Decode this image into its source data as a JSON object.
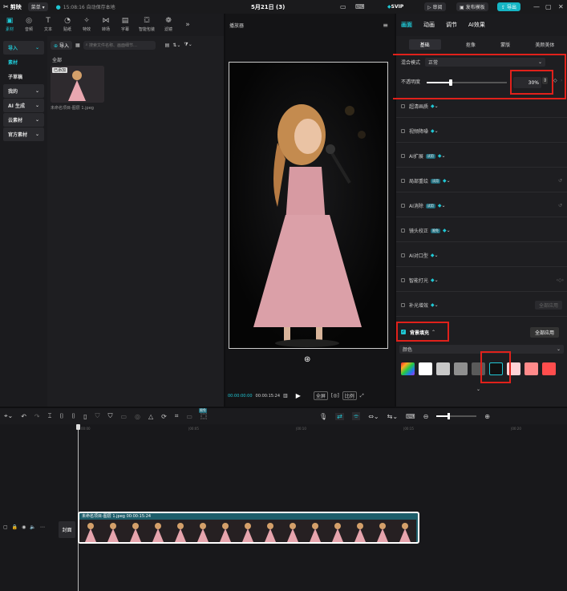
{
  "titlebar": {
    "app_name": "剪映",
    "menu": "菜单",
    "autosave": "15:08:16 自动保存本地",
    "project": "5月21日 (3)",
    "svip": "SVIP",
    "review": "审阅",
    "publish": "发布模板",
    "export": "导出"
  },
  "iconbar": {
    "items": [
      {
        "label": "素材",
        "icon": "media-icon"
      },
      {
        "label": "音频",
        "icon": "audio-icon"
      },
      {
        "label": "文本",
        "icon": "text-icon"
      },
      {
        "label": "贴纸",
        "icon": "sticker-icon"
      },
      {
        "label": "特效",
        "icon": "effects-icon"
      },
      {
        "label": "转场",
        "icon": "transition-icon"
      },
      {
        "label": "字幕",
        "icon": "caption-icon"
      },
      {
        "label": "智能包装",
        "icon": "smart-pack-icon"
      },
      {
        "label": "滤镜",
        "icon": "filter-icon"
      }
    ],
    "more": "»"
  },
  "sidebar": {
    "items": [
      {
        "label": "导入"
      },
      {
        "label": "素材"
      },
      {
        "label": "子草稿"
      },
      {
        "label": "我的"
      },
      {
        "label": "AI 生成"
      },
      {
        "label": "云素材"
      },
      {
        "label": "官方素材"
      }
    ]
  },
  "media": {
    "import_label": "导入",
    "search_placeholder": "搜索文件名称、画面细节…",
    "filter_all": "全部",
    "thumb_badge": "已添加",
    "file_name": "未命名项目-图层 1.jpeg"
  },
  "player": {
    "title": "播放器",
    "time_current": "00:00:00:00",
    "time_total": "00:00:15:24",
    "btn_full": "全屏",
    "btn_ratio": "比例"
  },
  "right": {
    "tabs": [
      "画面",
      "动画",
      "调节",
      "AI效果"
    ],
    "subtabs": [
      "基础",
      "抠像",
      "蒙版",
      "美颜美体"
    ],
    "blend_label": "混合模式",
    "blend_value": "正常",
    "opacity_label": "不透明度",
    "opacity_value": "30%",
    "opacity_fraction": 0.3,
    "rows": [
      "超清画质",
      "视频降噪",
      "AI扩展",
      "局部重绘",
      "AI消除",
      "镜头校正",
      "AI对口型",
      "智能打光",
      "补光增效"
    ],
    "row_pills": [
      "",
      "",
      "试用",
      "试用",
      "试用",
      "限免",
      "",
      "",
      ""
    ],
    "apply_all": "全部应用",
    "bg_fill": "背景填充",
    "bg_apply_all": "全部应用",
    "fill_type": "颜色",
    "swatches": [
      "#ffffff",
      "#c8c8c8",
      "#8f8f8f",
      "#5a5a5a",
      "#111111",
      "#ffd3d6",
      "#ff8a8a",
      "#ff4d4d"
    ]
  },
  "timeline": {
    "ticks": [
      "00:00",
      "|00:05",
      "|00:10",
      "|00:15",
      "|00:20"
    ],
    "clip_label": "未命名项目-图层 1.jpeg  00:00:15:24",
    "cover_label": "封面",
    "badge": "限免"
  }
}
